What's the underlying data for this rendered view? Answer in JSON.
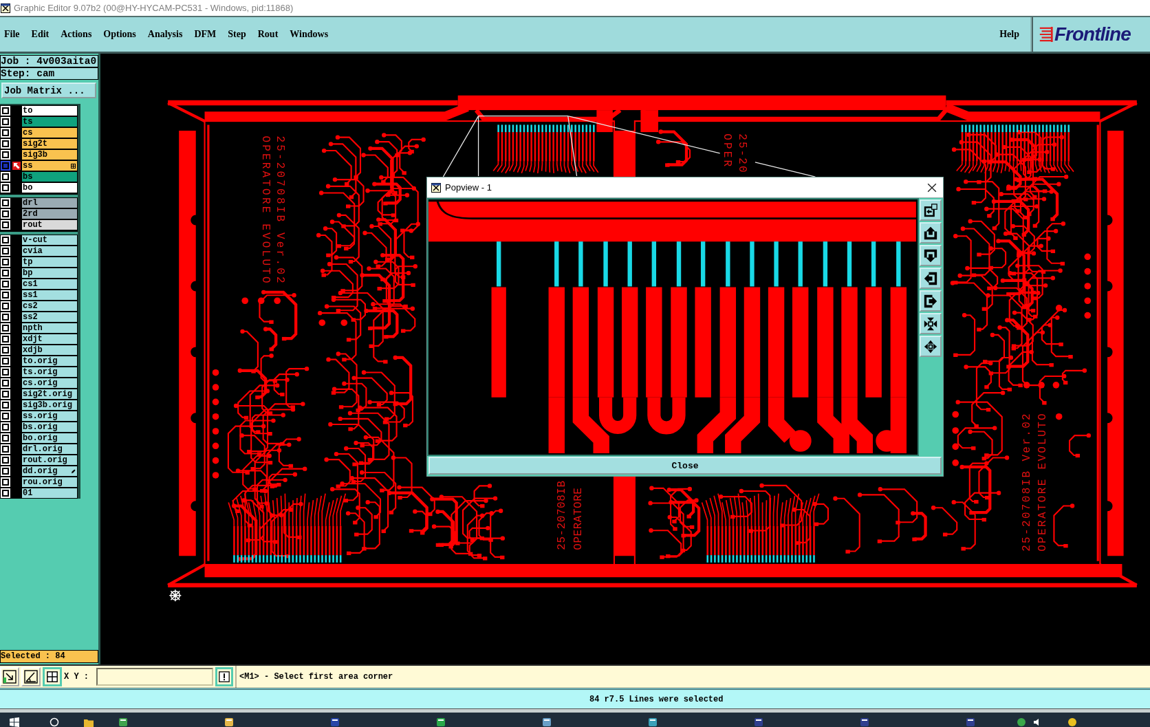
{
  "window": {
    "title": "Graphic Editor 9.07b2 (00@HY-HYCAM-PC531 - Windows, pid:11868)"
  },
  "menu": {
    "items": [
      "File",
      "Edit",
      "Actions",
      "Options",
      "Analysis",
      "DFM",
      "Step",
      "Rout",
      "Windows"
    ],
    "help": "Help",
    "logo": "Frontline"
  },
  "job_panel": {
    "job": "Job : 4v003aita0",
    "step": "Step: cam",
    "matrix_button": "Job Matrix ..."
  },
  "layer_groups": [
    {
      "layers": [
        {
          "name": "to",
          "color": "#ffffff",
          "selected": false,
          "attributes": false,
          "note": false
        },
        {
          "name": "ts",
          "color": "#10a27e",
          "selected": false,
          "attributes": false,
          "note": false
        },
        {
          "name": "cs",
          "color": "#f9c24f",
          "selected": false,
          "attributes": false,
          "note": false
        },
        {
          "name": "sig2t",
          "color": "#f9c24f",
          "selected": false,
          "attributes": false,
          "note": false
        },
        {
          "name": "sig3b",
          "color": "#f9c24f",
          "selected": false,
          "attributes": false,
          "note": false
        },
        {
          "name": "ss",
          "color": "#f9c24f",
          "selected": true,
          "attributes": true,
          "note": false
        },
        {
          "name": "bs",
          "color": "#10a27e",
          "selected": false,
          "attributes": false,
          "note": false
        },
        {
          "name": "bo",
          "color": "#ffffff",
          "selected": false,
          "attributes": false,
          "note": false
        }
      ]
    },
    {
      "layers": [
        {
          "name": "drl",
          "color": "#9aabb3",
          "selected": false,
          "attributes": false,
          "note": false
        },
        {
          "name": "2rd",
          "color": "#9aabb3",
          "selected": false,
          "attributes": false,
          "note": false
        },
        {
          "name": "rout",
          "color": "#d9d9d9",
          "selected": false,
          "attributes": false,
          "note": false
        }
      ]
    },
    {
      "layers": [
        {
          "name": "v-cut",
          "color": "#a3dfe0",
          "selected": false,
          "attributes": false,
          "note": false
        },
        {
          "name": "cvia",
          "color": "#a3dfe0",
          "selected": false,
          "attributes": false,
          "note": false
        },
        {
          "name": "tp",
          "color": "#a3dfe0",
          "selected": false,
          "attributes": false,
          "note": false
        },
        {
          "name": "bp",
          "color": "#a3dfe0",
          "selected": false,
          "attributes": false,
          "note": false
        },
        {
          "name": "cs1",
          "color": "#a3dfe0",
          "selected": false,
          "attributes": false,
          "note": false
        },
        {
          "name": "ss1",
          "color": "#a3dfe0",
          "selected": false,
          "attributes": false,
          "note": false
        },
        {
          "name": "cs2",
          "color": "#a3dfe0",
          "selected": false,
          "attributes": false,
          "note": false
        },
        {
          "name": "ss2",
          "color": "#a3dfe0",
          "selected": false,
          "attributes": false,
          "note": false
        },
        {
          "name": "npth",
          "color": "#a3dfe0",
          "selected": false,
          "attributes": false,
          "note": false
        },
        {
          "name": "xdjt",
          "color": "#a3dfe0",
          "selected": false,
          "attributes": false,
          "note": false
        },
        {
          "name": "xdjb",
          "color": "#a3dfe0",
          "selected": false,
          "attributes": false,
          "note": false
        },
        {
          "name": "to.orig",
          "color": "#a3dfe0",
          "selected": false,
          "attributes": false,
          "note": false
        },
        {
          "name": "ts.orig",
          "color": "#a3dfe0",
          "selected": false,
          "attributes": false,
          "note": false
        },
        {
          "name": "cs.orig",
          "color": "#a3dfe0",
          "selected": false,
          "attributes": false,
          "note": false
        },
        {
          "name": "sig2t.orig",
          "color": "#a3dfe0",
          "selected": false,
          "attributes": false,
          "note": false
        },
        {
          "name": "sig3b.orig",
          "color": "#a3dfe0",
          "selected": false,
          "attributes": false,
          "note": false
        },
        {
          "name": "ss.orig",
          "color": "#a3dfe0",
          "selected": false,
          "attributes": false,
          "note": false
        },
        {
          "name": "bs.orig",
          "color": "#a3dfe0",
          "selected": false,
          "attributes": false,
          "note": false
        },
        {
          "name": "bo.orig",
          "color": "#a3dfe0",
          "selected": false,
          "attributes": false,
          "note": false
        },
        {
          "name": "drl.orig",
          "color": "#a3dfe0",
          "selected": false,
          "attributes": false,
          "note": false
        },
        {
          "name": "rout.orig",
          "color": "#a3dfe0",
          "selected": false,
          "attributes": false,
          "note": false
        },
        {
          "name": "dd.orig",
          "color": "#a3dfe0",
          "selected": false,
          "attributes": false,
          "note": true
        },
        {
          "name": "rou.orig",
          "color": "#a3dfe0",
          "selected": false,
          "attributes": false,
          "note": false
        },
        {
          "name": "01",
          "color": "#a3dfe0",
          "selected": false,
          "attributes": false,
          "note": false
        }
      ]
    }
  ],
  "selection_count": "Selected : 84",
  "canvas": {
    "board_labels": [
      "OPERATORE EVOLUTO",
      "25-20708IB Ver.02",
      "OPER",
      "25-20",
      "25-20708IB",
      "OPERATORE",
      "25-20708IB Ver.02",
      "OPERATORE EVOLUTO"
    ]
  },
  "popview": {
    "title": "Popview - 1",
    "tools": [
      {
        "kind": "popout"
      },
      {
        "kind": "up"
      },
      {
        "kind": "down"
      },
      {
        "kind": "left"
      },
      {
        "kind": "right"
      },
      {
        "kind": "zoom_in"
      },
      {
        "kind": "zoom_out"
      }
    ],
    "close_button": "Close"
  },
  "command_bar": {
    "tools": [
      {
        "kind": "snap"
      },
      {
        "kind": "angle"
      },
      {
        "kind": "grid"
      }
    ],
    "xy_label": "X Y :",
    "prompt": "<M1> - Select first area corner"
  },
  "status_bar": {
    "message": "84 r7.5 Lines were selected"
  }
}
